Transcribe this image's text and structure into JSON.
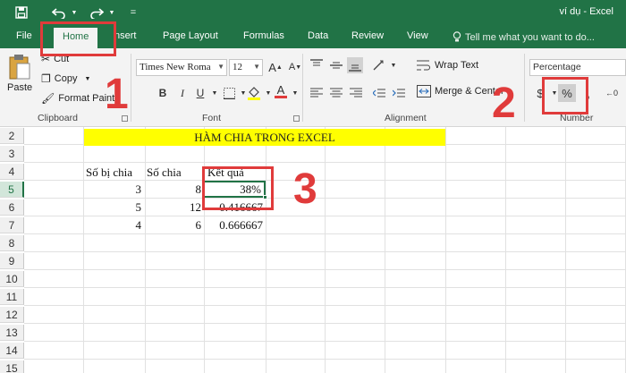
{
  "window": {
    "title": "ví dụ - Excel"
  },
  "quick_access": {
    "save_icon": "save-icon",
    "undo_icon": "undo-icon",
    "redo_icon": "redo-icon",
    "customize_glyph": "="
  },
  "tabs": [
    {
      "label": "File"
    },
    {
      "label": "Home"
    },
    {
      "label": "nsert"
    },
    {
      "label": "Page Layout"
    },
    {
      "label": "Formulas"
    },
    {
      "label": "Data"
    },
    {
      "label": "Review"
    },
    {
      "label": "View"
    }
  ],
  "tell_me": {
    "placeholder": "Tell me what you want to do..."
  },
  "clipboard": {
    "paste": "Paste",
    "cut": "Cut",
    "copy": "Copy",
    "format_painter": "Format Painte",
    "label": "Clipboard"
  },
  "font": {
    "name": "Times New Roma",
    "size": "12",
    "bold": "B",
    "italic": "I",
    "underline": "U",
    "font_color_letter": "A",
    "label": "Font"
  },
  "alignment": {
    "wrap_text": "Wrap Text",
    "merge_center": "Merge & Center",
    "label": "Alignment"
  },
  "number": {
    "format": "Percentage",
    "currency": "$",
    "percent": "%",
    "comma": ",",
    "label": "Number"
  },
  "rows": [
    "2",
    "3",
    "4",
    "5",
    "6",
    "7",
    "8",
    "9",
    "10",
    "11",
    "12",
    "13",
    "14",
    "15"
  ],
  "sheet": {
    "banner": "HÀM CHIA TRONG EXCEL",
    "headers": {
      "a": "Số bị chia",
      "b": "Số chia",
      "c": "Kết quả"
    },
    "r5": {
      "a": "3",
      "b": "8",
      "c": "38%"
    },
    "r6": {
      "a": "5",
      "b": "12",
      "c": "0.416667"
    },
    "r7": {
      "a": "4",
      "b": "6",
      "c": "0.666667"
    }
  },
  "annotations": {
    "step1": "1",
    "step2": "2",
    "step3": "3"
  },
  "colors": {
    "excel_green": "#217346",
    "annotation_red": "#e03b3b",
    "banner_yellow": "#ffff00"
  }
}
